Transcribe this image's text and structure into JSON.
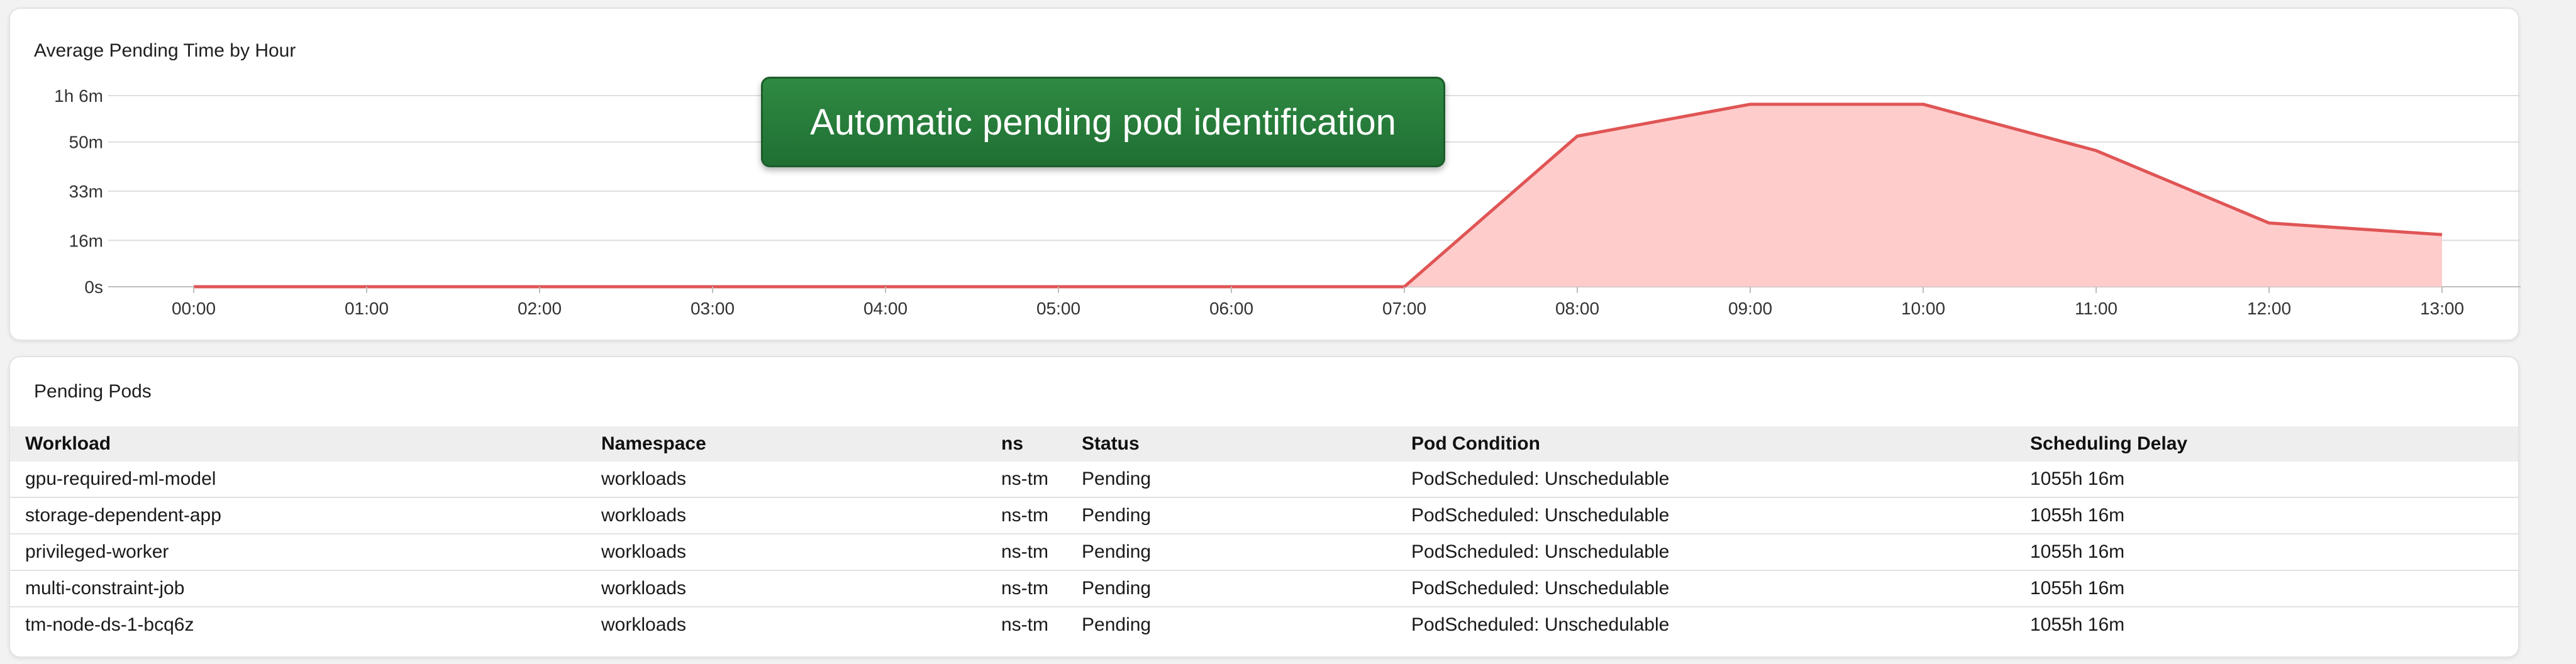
{
  "chart_panel": {
    "title": "Average Pending Time by Hour",
    "callout": "Automatic pending pod identification"
  },
  "chart_data": {
    "type": "area",
    "title": "Average Pending Time by Hour",
    "x": [
      "00:00",
      "01:00",
      "02:00",
      "03:00",
      "04:00",
      "05:00",
      "06:00",
      "07:00",
      "08:00",
      "09:00",
      "10:00",
      "11:00",
      "12:00",
      "13:00"
    ],
    "values_minutes": [
      0,
      0,
      0,
      0,
      0,
      0,
      0,
      0,
      52,
      63,
      63,
      47,
      22,
      18
    ],
    "y_ticks": [
      {
        "value": 0,
        "label": "0s"
      },
      {
        "value": 16,
        "label": "16m"
      },
      {
        "value": 33,
        "label": "33m"
      },
      {
        "value": 50,
        "label": "50m"
      },
      {
        "value": 66,
        "label": "1h 6m"
      }
    ],
    "ylim": [
      0,
      66
    ],
    "grid": true,
    "line_color": "#e05555",
    "fill_color": "#ffcccc"
  },
  "pods_panel": {
    "title": "Pending Pods",
    "columns": {
      "workload": "Workload",
      "namespace": "Namespace",
      "ns": "ns",
      "status": "Status",
      "condition": "Pod Condition",
      "delay": "Scheduling Delay"
    },
    "rows": [
      {
        "workload": "gpu-required-ml-model",
        "namespace": "workloads",
        "ns": "ns-tm",
        "status": "Pending",
        "condition": "PodScheduled: Unschedulable",
        "delay": "1055h 16m"
      },
      {
        "workload": "storage-dependent-app",
        "namespace": "workloads",
        "ns": "ns-tm",
        "status": "Pending",
        "condition": "PodScheduled: Unschedulable",
        "delay": "1055h 16m"
      },
      {
        "workload": "privileged-worker",
        "namespace": "workloads",
        "ns": "ns-tm",
        "status": "Pending",
        "condition": "PodScheduled: Unschedulable",
        "delay": "1055h 16m"
      },
      {
        "workload": "multi-constraint-job",
        "namespace": "workloads",
        "ns": "ns-tm",
        "status": "Pending",
        "condition": "PodScheduled: Unschedulable",
        "delay": "1055h 16m"
      },
      {
        "workload": "tm-node-ds-1-bcq6z",
        "namespace": "workloads",
        "ns": "ns-tm",
        "status": "Pending",
        "condition": "PodScheduled: Unschedulable",
        "delay": "1055h 16m"
      }
    ]
  }
}
